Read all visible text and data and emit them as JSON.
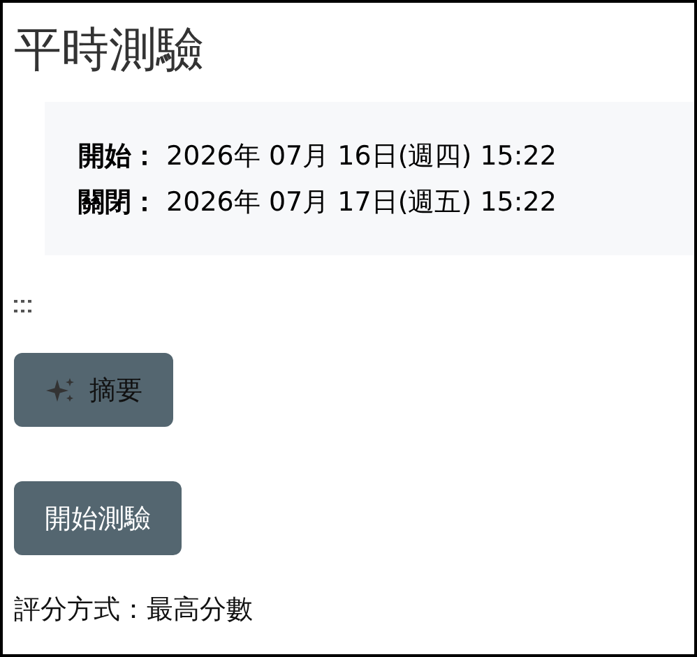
{
  "title": "平時測驗",
  "dates": [
    {
      "label": "開始：",
      "value": "2026年 07月 16日(週四) 15:22"
    },
    {
      "label": "關閉：",
      "value": "2026年 07月 17日(週五) 15:22"
    }
  ],
  "summary_button": {
    "label": "摘要"
  },
  "start_button": {
    "label": "開始測驗"
  },
  "grading": "評分方式：最高分數"
}
